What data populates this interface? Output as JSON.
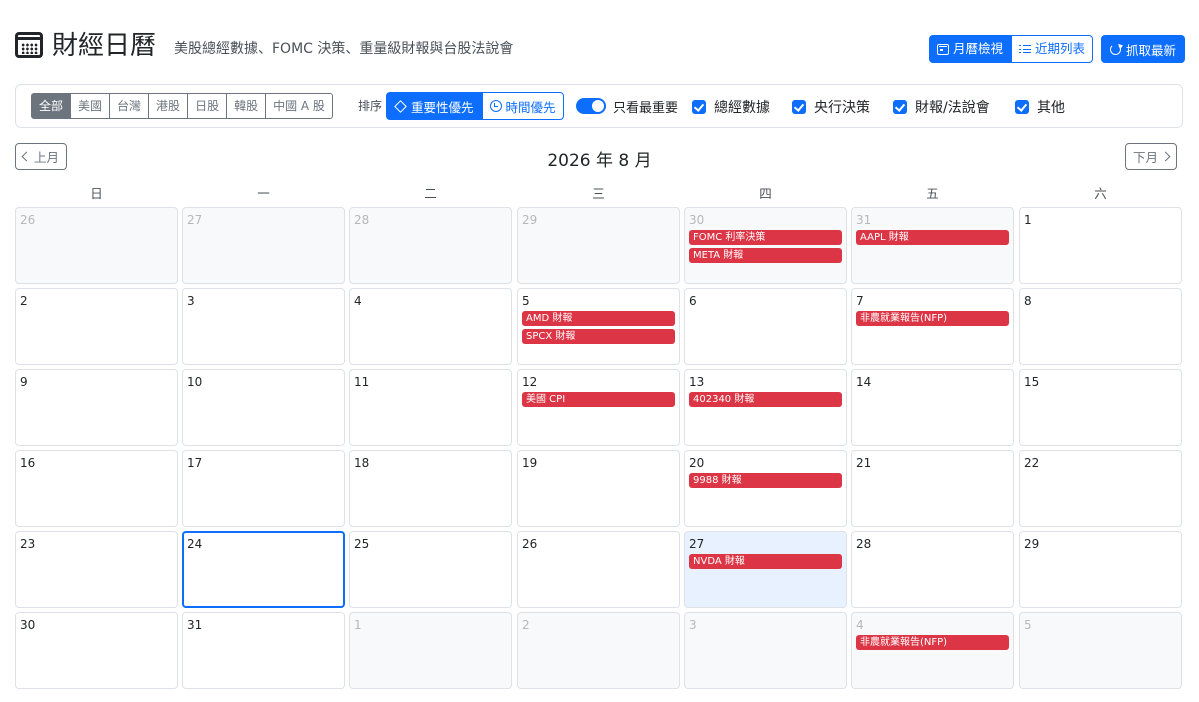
{
  "header": {
    "title": "財經日曆",
    "subtitle": "美股總經數據、FOMC 決策、重量級財報與台股法說會",
    "view_buttons": [
      {
        "label": "月曆檢視",
        "icon": "calendar-icon",
        "active": true
      },
      {
        "label": "近期列表",
        "icon": "list-icon",
        "active": false
      }
    ],
    "fetch_label": "抓取最新"
  },
  "filters": {
    "markets": [
      "全部",
      "美國",
      "台灣",
      "港股",
      "日股",
      "韓股",
      "中國 A 股"
    ],
    "market_selected": "全部",
    "sort_label": "排序",
    "sort_options": [
      {
        "label": "重要性優先",
        "icon": "diamond-icon",
        "active": true
      },
      {
        "label": "時間優先",
        "icon": "clock-icon",
        "active": false
      }
    ],
    "important_only_label": "只看最重要",
    "important_only": true,
    "categories": [
      {
        "label": "總經數據",
        "checked": true
      },
      {
        "label": "央行決策",
        "checked": true
      },
      {
        "label": "財報/法說會",
        "checked": true
      },
      {
        "label": "其他",
        "checked": true
      }
    ]
  },
  "calendar": {
    "prev_label": "上月",
    "next_label": "下月",
    "month_title": "2026 年 8 月",
    "weekdays": [
      "日",
      "一",
      "二",
      "三",
      "四",
      "五",
      "六"
    ],
    "weeks": [
      [
        {
          "day": "26",
          "other": true,
          "events": []
        },
        {
          "day": "27",
          "other": true,
          "events": []
        },
        {
          "day": "28",
          "other": true,
          "events": []
        },
        {
          "day": "29",
          "other": true,
          "events": []
        },
        {
          "day": "30",
          "other": true,
          "events": [
            "FOMC 利率決策",
            "META 財報"
          ]
        },
        {
          "day": "31",
          "other": true,
          "events": [
            "AAPL 財報"
          ]
        },
        {
          "day": "1",
          "events": []
        }
      ],
      [
        {
          "day": "2",
          "events": []
        },
        {
          "day": "3",
          "events": []
        },
        {
          "day": "4",
          "events": []
        },
        {
          "day": "5",
          "events": [
            "AMD 財報",
            "SPCX 財報"
          ]
        },
        {
          "day": "6",
          "events": []
        },
        {
          "day": "7",
          "events": [
            "非農就業報告(NFP)"
          ]
        },
        {
          "day": "8",
          "events": []
        }
      ],
      [
        {
          "day": "9",
          "events": []
        },
        {
          "day": "10",
          "events": []
        },
        {
          "day": "11",
          "events": []
        },
        {
          "day": "12",
          "events": [
            "美國 CPI"
          ]
        },
        {
          "day": "13",
          "events": [
            "402340 財報"
          ]
        },
        {
          "day": "14",
          "events": []
        },
        {
          "day": "15",
          "events": []
        }
      ],
      [
        {
          "day": "16",
          "events": []
        },
        {
          "day": "17",
          "events": []
        },
        {
          "day": "18",
          "events": []
        },
        {
          "day": "19",
          "events": []
        },
        {
          "day": "20",
          "events": [
            "9988 財報"
          ]
        },
        {
          "day": "21",
          "events": []
        },
        {
          "day": "22",
          "events": []
        }
      ],
      [
        {
          "day": "23",
          "events": []
        },
        {
          "day": "24",
          "today": true,
          "events": []
        },
        {
          "day": "25",
          "events": []
        },
        {
          "day": "26",
          "events": []
        },
        {
          "day": "27",
          "highlight": true,
          "events": [
            "NVDA 財報"
          ]
        },
        {
          "day": "28",
          "events": []
        },
        {
          "day": "29",
          "events": []
        }
      ],
      [
        {
          "day": "30",
          "events": []
        },
        {
          "day": "31",
          "events": []
        },
        {
          "day": "1",
          "other": true,
          "events": []
        },
        {
          "day": "2",
          "other": true,
          "events": []
        },
        {
          "day": "3",
          "other": true,
          "events": []
        },
        {
          "day": "4",
          "other": true,
          "events": [
            "非農就業報告(NFP)"
          ]
        },
        {
          "day": "5",
          "other": true,
          "events": []
        }
      ]
    ]
  },
  "colors": {
    "primary": "#0d6efd",
    "event": "#dc3545",
    "secondary": "#6c757d",
    "highlight": "#e7f1ff"
  }
}
